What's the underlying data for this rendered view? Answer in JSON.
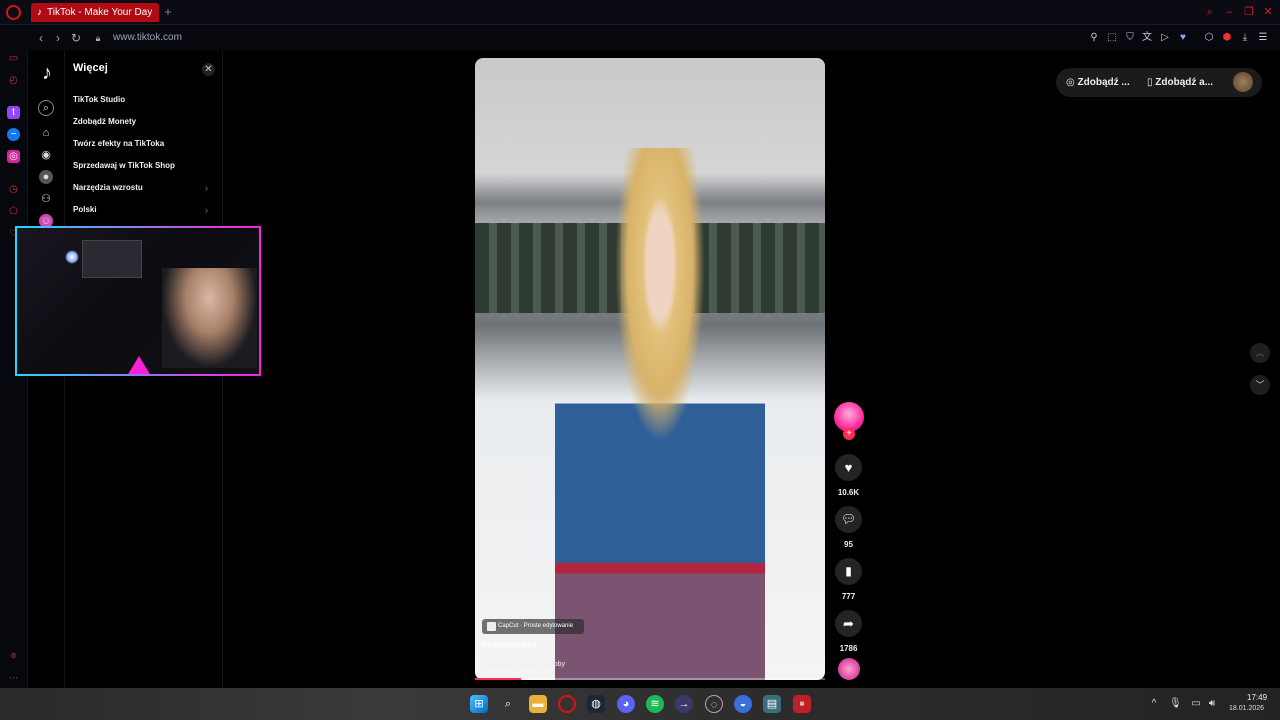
{
  "browser": {
    "tab_title": "TikTok - Make Your Day",
    "url": "www.tiktok.com",
    "new_tab": "+"
  },
  "more_panel": {
    "title": "Więcej",
    "items": [
      {
        "label": "TikTok Studio",
        "has_chevron": false
      },
      {
        "label": "Zdobądź Monety",
        "has_chevron": false
      },
      {
        "label": "Twórz efekty na TikToka",
        "has_chevron": false
      },
      {
        "label": "Sprzedawaj w TikTok Shop",
        "has_chevron": false
      },
      {
        "label": "Narzędzia wzrostu",
        "has_chevron": true
      },
      {
        "label": "Polski",
        "has_chevron": true
      }
    ]
  },
  "header": {
    "coins_button": "Zdobądź ...",
    "app_button": "Zdobądź a..."
  },
  "video": {
    "capcut_label": "CapCut · Proste edytowanie",
    "username": "lenapolanskipl",
    "description": "Wspierajcie polskie wyroby",
    "progress": 0.13
  },
  "actions": {
    "likes": "10.6K",
    "comments": "95",
    "saves": "777",
    "shares": "1786"
  },
  "taskbar": {
    "time": "17:49",
    "date": "18.01.2026"
  },
  "colors": {
    "tab_active": "#b00b14",
    "tiktok_red": "#fe2c55",
    "opera_red": "#dd1111"
  }
}
